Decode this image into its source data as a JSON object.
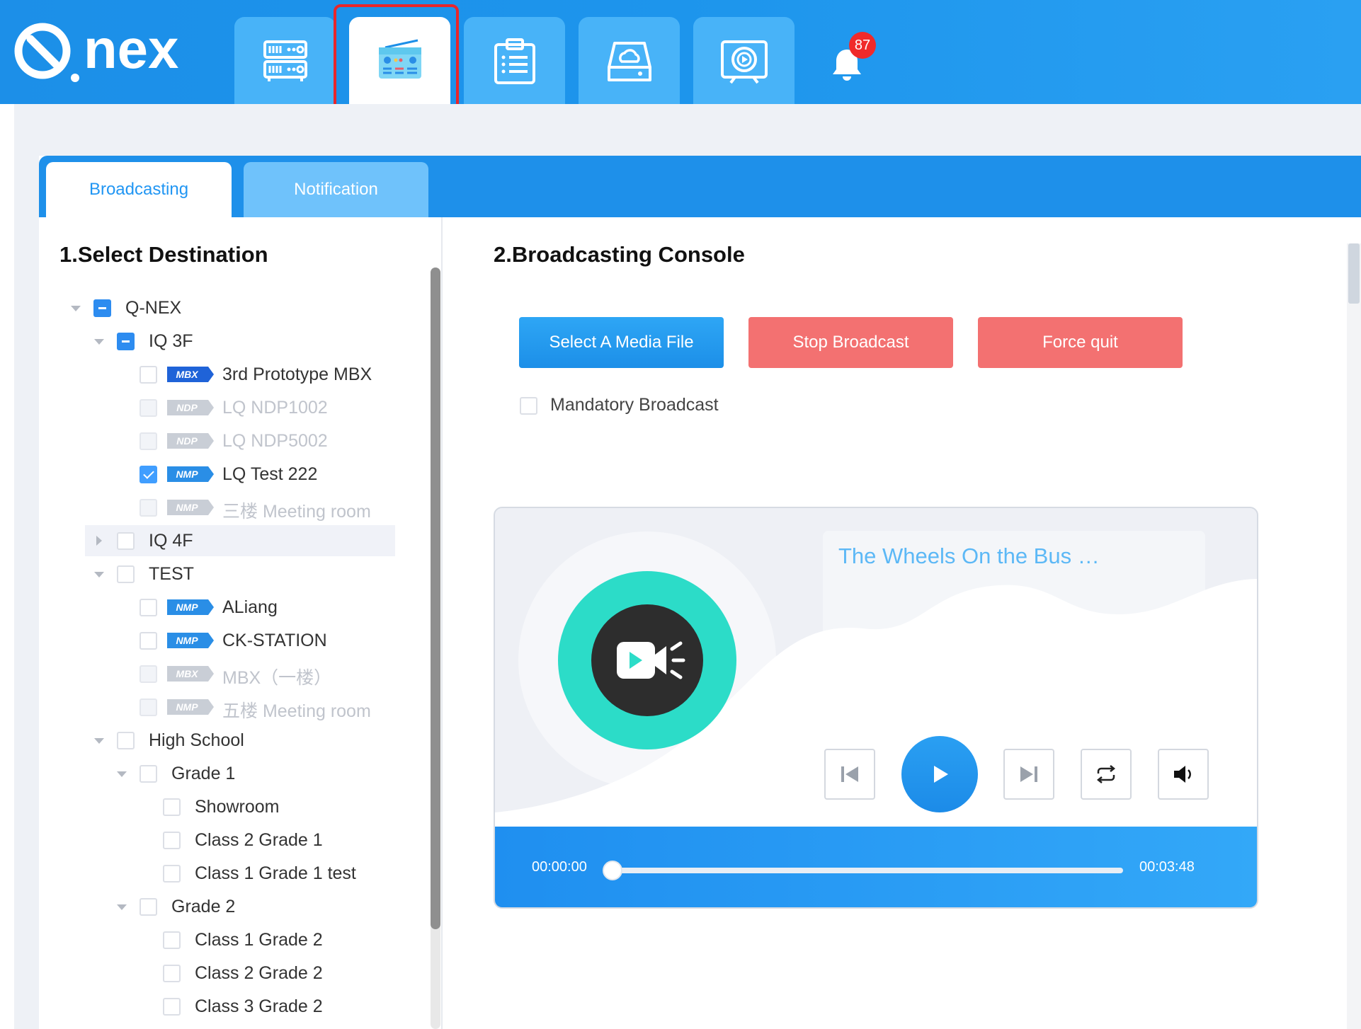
{
  "header": {
    "logo_text": "Q.nex",
    "nav_icons": [
      "server-icon",
      "radio-icon",
      "clipboard-icon",
      "cloud-drive-icon",
      "media-player-icon"
    ],
    "active_nav_index": 1,
    "notification_count": "87"
  },
  "tabs": {
    "active": "Broadcasting",
    "inactive": "Notification"
  },
  "left": {
    "title": "1.Select Destination"
  },
  "tree": [
    {
      "label": "Q-NEX",
      "level": 0,
      "caret": "down",
      "check": "indet"
    },
    {
      "label": "IQ 3F",
      "level": 1,
      "caret": "down",
      "check": "indet"
    },
    {
      "label": "3rd Prototype MBX",
      "level": 2,
      "tag": "MBX",
      "check": "none"
    },
    {
      "label": "LQ NDP1002",
      "level": 2,
      "tag": "NDP",
      "check": "disabled"
    },
    {
      "label": "LQ NDP5002",
      "level": 2,
      "tag": "NDP",
      "check": "disabled"
    },
    {
      "label": "LQ Test 222",
      "level": 2,
      "tag": "NMP",
      "check": "checked"
    },
    {
      "label": "三楼 Meeting room",
      "level": 2,
      "tag": "NMP",
      "check": "disabled"
    },
    {
      "label": "IQ 4F",
      "level": 1,
      "caret": "right",
      "check": "none"
    },
    {
      "label": "TEST",
      "level": 1,
      "caret": "down",
      "check": "none"
    },
    {
      "label": "ALiang",
      "level": 2,
      "tag": "NMP",
      "check": "none"
    },
    {
      "label": "CK-STATION",
      "level": 2,
      "tag": "NMP",
      "check": "none"
    },
    {
      "label": "MBX（一楼）",
      "level": 2,
      "tag": "MBX",
      "check": "disabled"
    },
    {
      "label": "五楼 Meeting room",
      "level": 2,
      "tag": "NMP",
      "check": "disabled"
    },
    {
      "label": "High School",
      "level": 1,
      "caret": "down",
      "check": "none"
    },
    {
      "label": "Grade 1",
      "level": 2,
      "caret": "down",
      "check": "none"
    },
    {
      "label": "Showroom",
      "level": 3,
      "check": "none"
    },
    {
      "label": "Class 2 Grade 1",
      "level": 3,
      "check": "none"
    },
    {
      "label": "Class 1 Grade 1 test",
      "level": 3,
      "check": "none"
    },
    {
      "label": "Grade 2",
      "level": 2,
      "caret": "down",
      "check": "none"
    },
    {
      "label": "Class 1 Grade 2",
      "level": 3,
      "check": "none"
    },
    {
      "label": "Class 2 Grade 2",
      "level": 3,
      "check": "none"
    },
    {
      "label": "Class 3 Grade 2",
      "level": 3,
      "check": "none"
    }
  ],
  "right": {
    "title": "2.Broadcasting Console",
    "select_media": "Select A Media File",
    "stop_broadcast": "Stop Broadcast",
    "force_quit": "Force quit",
    "mandatory_label": "Mandatory Broadcast",
    "mandatory_checked": false
  },
  "player": {
    "track_title": "The Wheels On the Bus …",
    "current_time": "00:00:00",
    "total_time": "00:03:48",
    "progress": 0
  },
  "colors": {
    "brand_blue": "#1c8fe8",
    "danger": "#f37171",
    "accent_teal": "#2cdcc8",
    "badge_red": "#f02a2a"
  }
}
